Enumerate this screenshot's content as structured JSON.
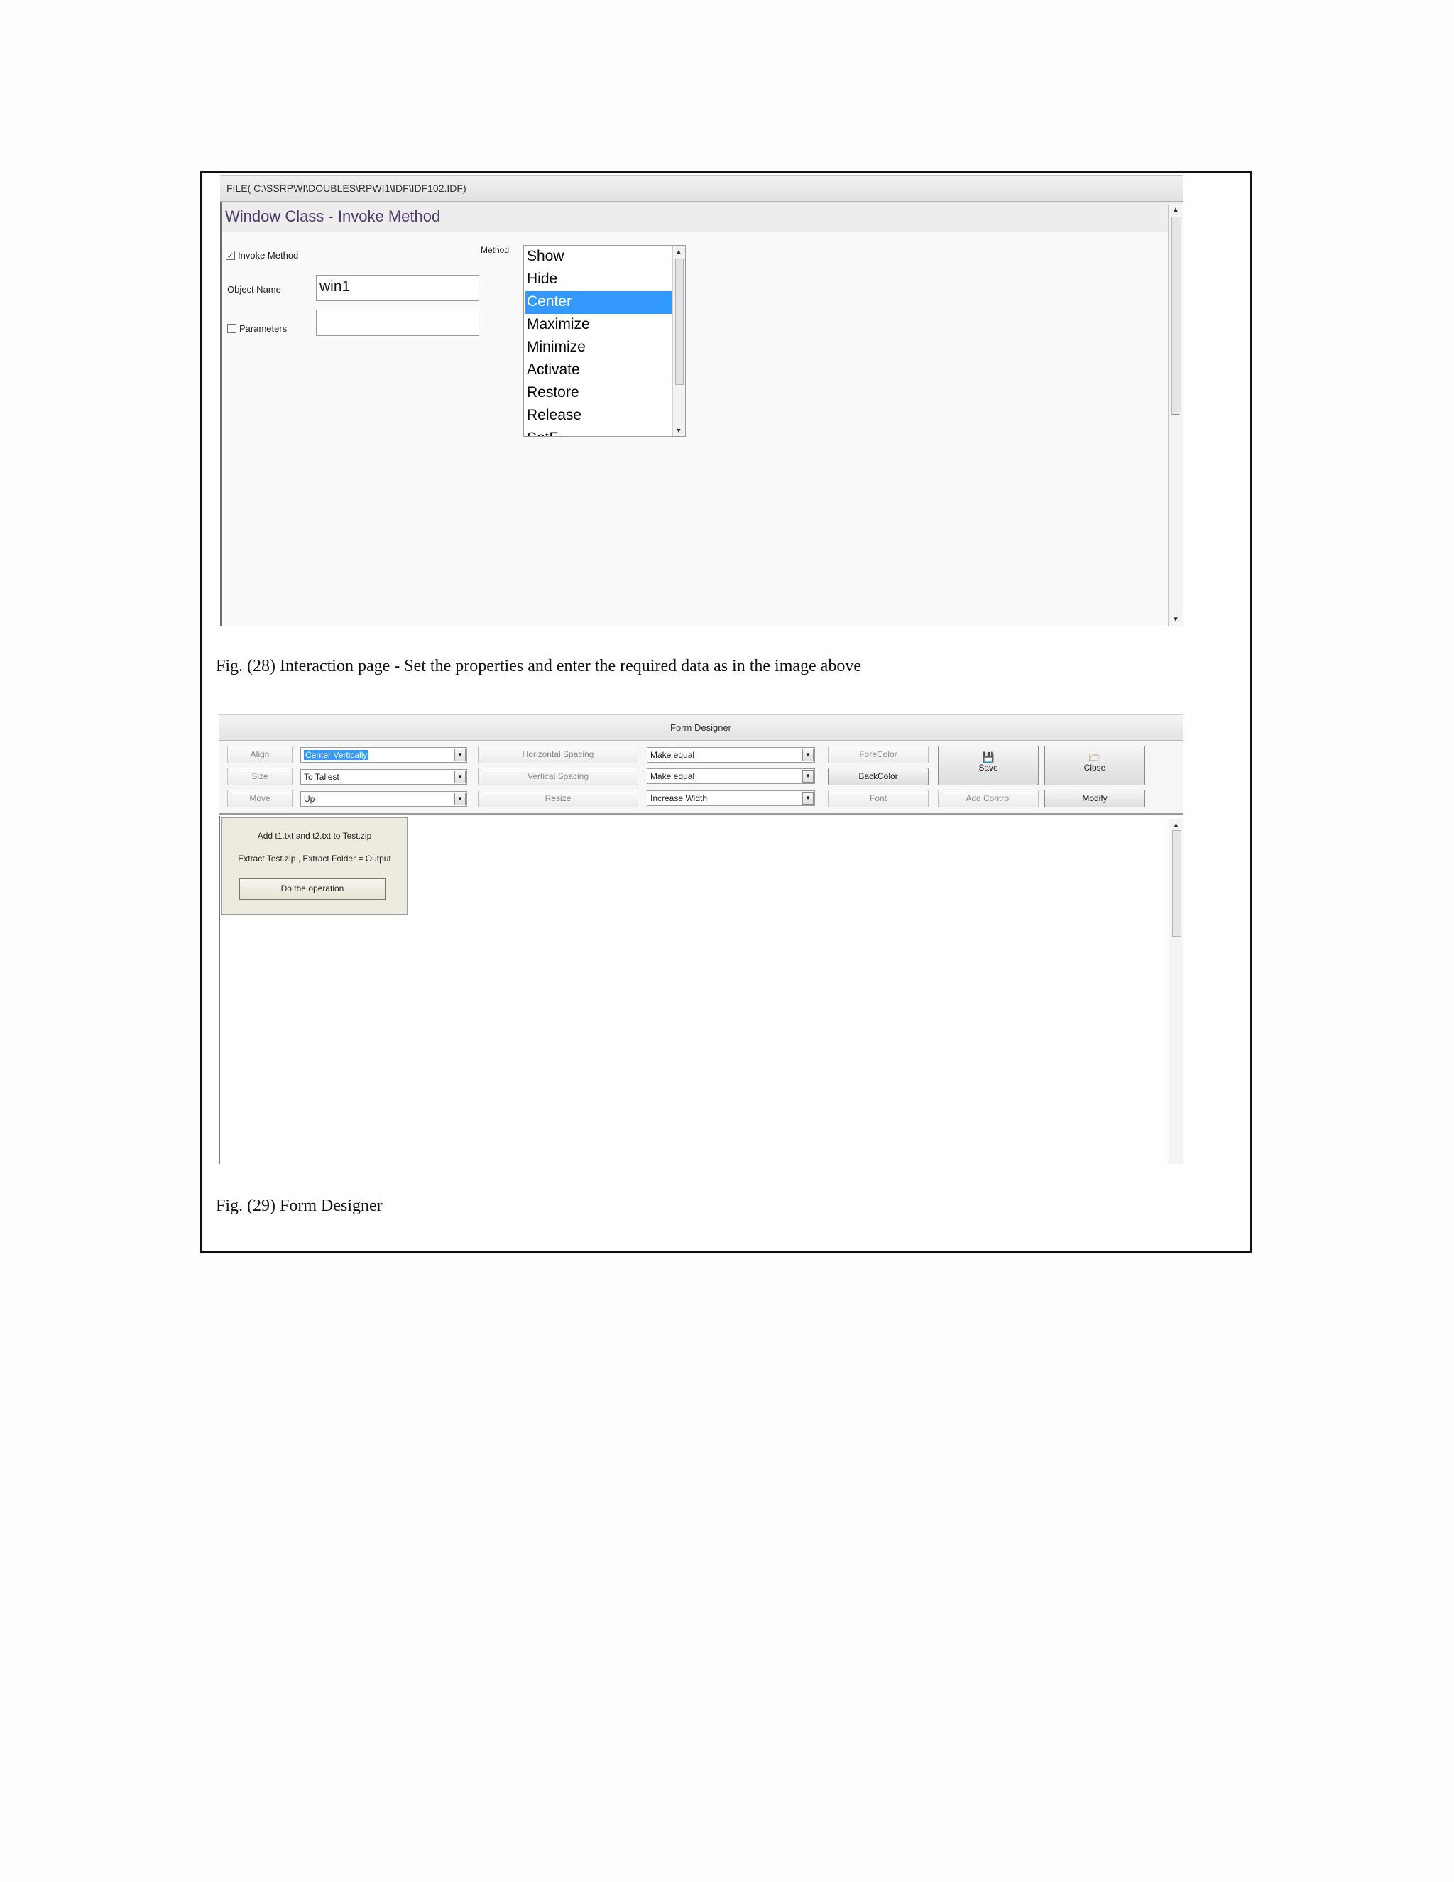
{
  "fig28": {
    "file_path": "FILE( C:\\SSRPWI\\DOUBLES\\RPWI1\\IDF\\IDF102.IDF)",
    "window_title": "Window Class - Invoke Method",
    "invoke_method_label": "Invoke Method",
    "invoke_method_checked": true,
    "object_name_label": "Object Name",
    "object_name_value": "win1",
    "parameters_label": "Parameters",
    "parameters_checked": false,
    "parameters_value": "",
    "method_label": "Method",
    "methods": [
      "Show",
      "Hide",
      "Center",
      "Maximize",
      "Minimize",
      "Activate",
      "Restore",
      "Release",
      "SetF"
    ],
    "selected_method": "Center",
    "caption": "Fig. (28) Interaction page - Set the properties and enter the required data as in the image above"
  },
  "fig29": {
    "title": "Form Designer",
    "toolbar": {
      "align_label": "Align",
      "size_label": "Size",
      "move_label": "Move",
      "align_value": "Center Vertically",
      "size_value": "To Tallest",
      "move_value": "Up",
      "horizontal_spacing_label": "Horizontal Spacing",
      "vertical_spacing_label": "Vertical Spacing",
      "resize_label": "Resize",
      "horizontal_spacing_value": "Make equal",
      "vertical_spacing_value": "Make equal",
      "resize_value": "Increase Width",
      "forecolor_label": "ForeColor",
      "backcolor_label": "BackColor",
      "font_label": "Font",
      "save_label": "Save",
      "close_label": "Close",
      "add_control_label": "Add Control",
      "modify_label": "Modify"
    },
    "designed_form": {
      "line1": "Add t1.txt and t2.txt to Test.zip",
      "line2": "Extract Test.zip , Extract Folder = Output",
      "button_label": "Do the operation"
    },
    "caption": "Fig. (29) Form Designer"
  },
  "colors": {
    "selection": "#3399ff",
    "window_title_text": "#4d3b6b",
    "designed_form_bg": "#edeade"
  }
}
